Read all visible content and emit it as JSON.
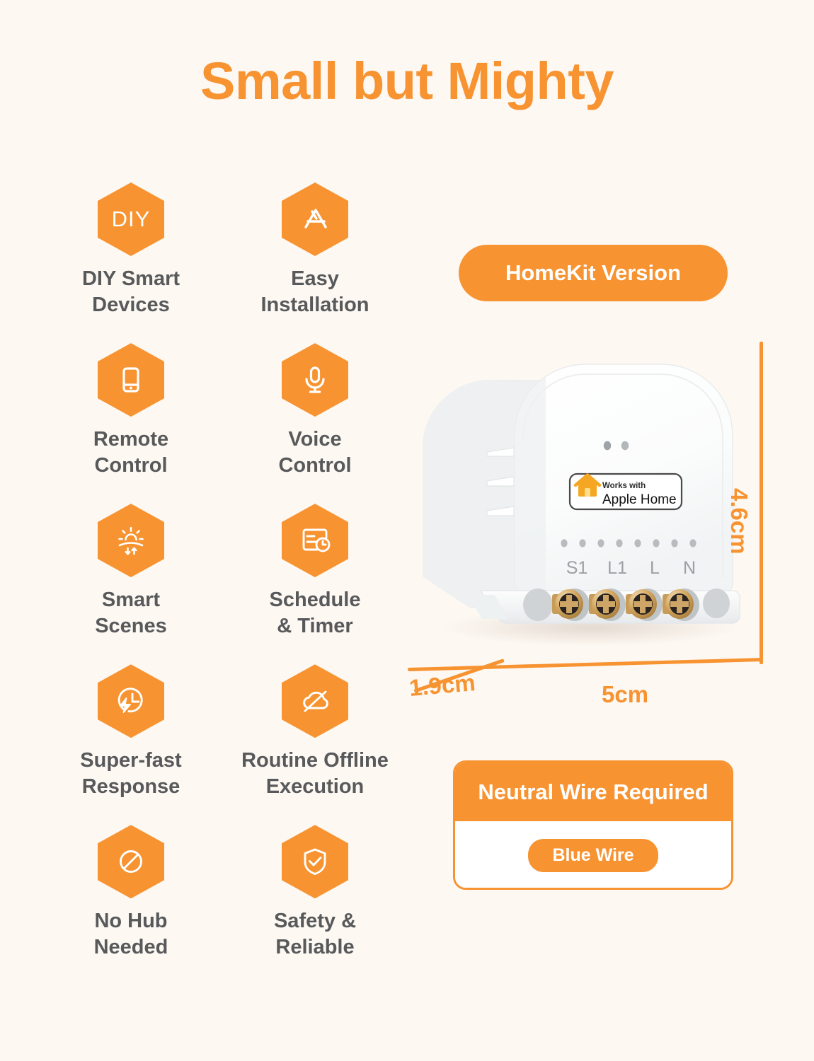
{
  "title": "Small but Mighty",
  "colors": {
    "accent": "#f79331",
    "background": "#fdf8f2",
    "label_text": "#58595b",
    "card_white": "#ffffff"
  },
  "features": [
    {
      "icon": "diy-icon",
      "icon_text": "DIY",
      "label": "DIY Smart\nDevices"
    },
    {
      "icon": "app-store-icon",
      "icon_text": "",
      "label": "Easy\nInstallation"
    },
    {
      "icon": "smartphone-icon",
      "icon_text": "",
      "label": "Remote\nControl"
    },
    {
      "icon": "microphone-icon",
      "icon_text": "",
      "label": "Voice\nControl"
    },
    {
      "icon": "sunrise-sunset-icon",
      "icon_text": "",
      "label": "Smart\nScenes"
    },
    {
      "icon": "calendar-clock-icon",
      "icon_text": "",
      "label": "Schedule\n& Timer"
    },
    {
      "icon": "clock-bolt-icon",
      "icon_text": "",
      "label": "Super-fast\nResponse"
    },
    {
      "icon": "cloud-slash-icon",
      "icon_text": "",
      "label": "Routine Offline\nExecution"
    },
    {
      "icon": "prohibition-icon",
      "icon_text": "",
      "label": "No Hub\nNeeded"
    },
    {
      "icon": "shield-check-icon",
      "icon_text": "",
      "label": "Safety &\nReliable"
    }
  ],
  "version_badge": {
    "label": "HomeKit Version"
  },
  "device": {
    "certification_badge": {
      "works_with": "Works with",
      "platform": "Apple Home",
      "house_icon": "apple-home-house-icon"
    },
    "terminals": [
      "S1",
      "L1",
      "L",
      "N"
    ],
    "led_count": 2,
    "vent_slots": 3,
    "terminal_dots": 8
  },
  "dimensions": {
    "height": "4.6cm",
    "depth": "1.9cm",
    "width": "5cm"
  },
  "neutral_wire": {
    "header": "Neutral Wire Required",
    "pill_label": "Blue Wire"
  }
}
